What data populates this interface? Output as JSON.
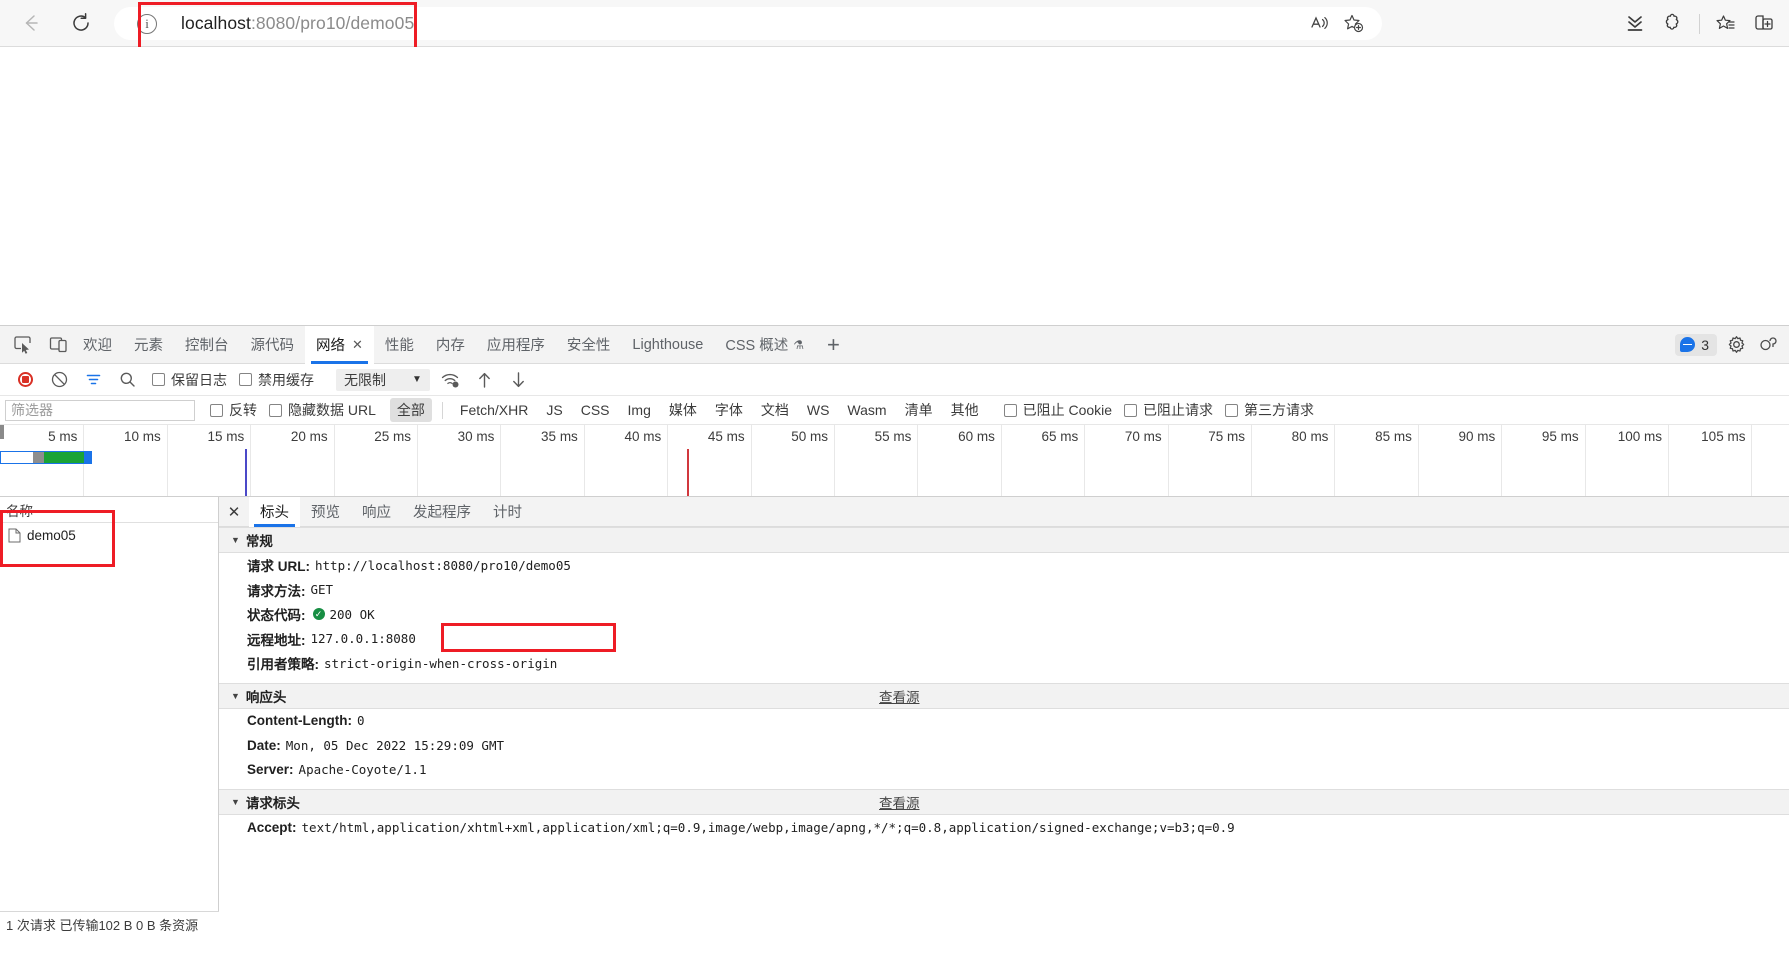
{
  "browser": {
    "url_host": "localhost",
    "url_rest": ":8080/pro10/demo05",
    "back_icon": "back-arrow-icon",
    "reload_icon": "reload-icon",
    "info_icon": "info-icon",
    "read_aloud_icon": "read-aloud-icon",
    "add_favorite_icon": "add-favorite-icon",
    "downloads_icon": "downloads-icon",
    "extensions_icon": "extensions-icon",
    "favorites_icon": "favorites-icon",
    "split_screen_icon": "split-screen-icon"
  },
  "devtools": {
    "dock_icons": [
      "inspect-element-icon",
      "device-toolbar-icon"
    ],
    "tabs": [
      {
        "label": "欢迎",
        "active": false
      },
      {
        "label": "元素",
        "active": false
      },
      {
        "label": "控制台",
        "active": false
      },
      {
        "label": "源代码",
        "active": false
      },
      {
        "label": "网络",
        "active": true,
        "close": "✕"
      },
      {
        "label": "性能",
        "active": false
      },
      {
        "label": "内存",
        "active": false
      },
      {
        "label": "应用程序",
        "active": false
      },
      {
        "label": "安全性",
        "active": false
      },
      {
        "label": "Lighthouse",
        "active": false
      },
      {
        "label": "CSS 概述",
        "active": false,
        "flask": "⚗"
      }
    ],
    "add_tab_label": "+",
    "message_count": "3",
    "settings_icon": "gear-icon",
    "more_icon": "customize-devtools-icon"
  },
  "network_toolbar": {
    "record_icon": "record-stop-icon",
    "clear_icon": "clear-icon",
    "filter_icon": "filter-icon",
    "search_icon": "search-icon",
    "preserve_log_label": "保留日志",
    "disable_cache_label": "禁用缓存",
    "throttle_value": "无限制",
    "throttle_caret": "▼",
    "wifi_icon": "network-conditions-icon",
    "import_icon": "import-har-icon",
    "export_icon": "export-har-icon"
  },
  "filter_row": {
    "placeholder": "筛选器",
    "invert_label": "反转",
    "hide_data_url_label": "隐藏数据 URL",
    "types": [
      "全部",
      "Fetch/XHR",
      "JS",
      "CSS",
      "Img",
      "媒体",
      "字体",
      "文档",
      "WS",
      "Wasm",
      "清单",
      "其他"
    ],
    "selected_type": "全部",
    "blocked_cookies_label": "已阻止 Cookie",
    "blocked_requests_label": "已阻止请求",
    "third_party_label": "第三方请求"
  },
  "timeline": {
    "ticks": [
      "5 ms",
      "10 ms",
      "15 ms",
      "20 ms",
      "25 ms",
      "30 ms",
      "35 ms",
      "40 ms",
      "45 ms",
      "50 ms",
      "55 ms",
      "60 ms",
      "65 ms",
      "70 ms",
      "75 ms",
      "80 ms",
      "85 ms",
      "90 ms",
      "95 ms",
      "100 ms",
      "105 ms"
    ],
    "dom_content_loaded_color": "#4b49c8",
    "load_color": "#d1383d"
  },
  "requests_pane": {
    "column_header": "名称",
    "rows": [
      {
        "name": "demo05",
        "icon": "document-file-icon"
      }
    ],
    "status_text": "1 次请求  已传输102 B  0 B 条资源"
  },
  "detail_pane": {
    "close_icon": "✕",
    "tabs": [
      {
        "label": "标头",
        "active": true
      },
      {
        "label": "预览",
        "active": false
      },
      {
        "label": "响应",
        "active": false
      },
      {
        "label": "发起程序",
        "active": false
      },
      {
        "label": "计时",
        "active": false
      }
    ],
    "sections": [
      {
        "title": "常规",
        "view_source": "",
        "rows": [
          {
            "key": "请求 URL:",
            "value": "http://localhost:8080/pro10/demo05"
          },
          {
            "key": "请求方法:",
            "value": "GET"
          },
          {
            "key": "状态代码:",
            "value": "200 OK",
            "status_ok": true
          },
          {
            "key": "远程地址:",
            "value": "127.0.0.1:8080"
          },
          {
            "key": "引用者策略:",
            "value": "strict-origin-when-cross-origin"
          }
        ]
      },
      {
        "title": "响应头",
        "view_source": "查看源",
        "rows": [
          {
            "key": "Content-Length:",
            "value": "0"
          },
          {
            "key": "Date:",
            "value": "Mon, 05 Dec 2022 15:29:09 GMT"
          },
          {
            "key": "Server:",
            "value": "Apache-Coyote/1.1"
          }
        ]
      },
      {
        "title": "请求标头",
        "view_source": "查看源",
        "rows": [
          {
            "key": "Accept:",
            "value": "text/html,application/xhtml+xml,application/xml;q=0.9,image/webp,image/apng,*/*;q=0.8,application/signed-exchange;v=b3;q=0.9"
          }
        ]
      }
    ]
  },
  "annotations": {
    "color": "#ee1c25",
    "boxes": [
      "url-bar-highlight",
      "request-name-highlight",
      "status-code-highlight"
    ]
  }
}
